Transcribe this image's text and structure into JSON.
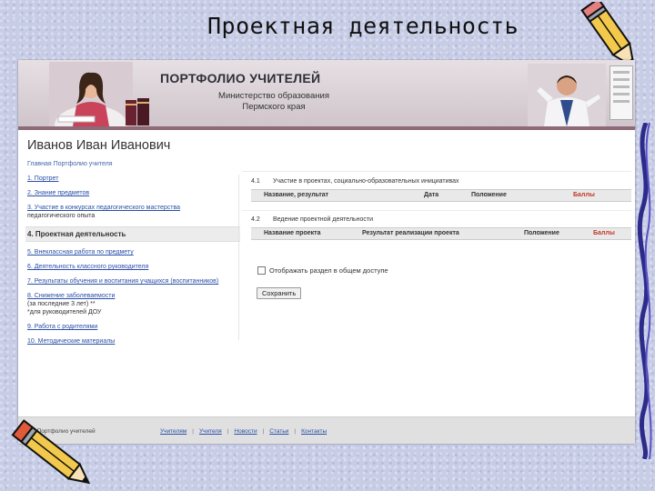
{
  "slide": {
    "title": "Проектная деятельность"
  },
  "header": {
    "site_title": "ПОРТФОЛИО УЧИТЕЛЕЙ",
    "ministry_line1": "Министерство образования",
    "ministry_line2": "Пермского края"
  },
  "user": {
    "name": "Иванов Иван Иванович"
  },
  "breadcrumb": "Главная   Портфолио учителя",
  "nav": {
    "items": [
      {
        "label": "1. Портрет"
      },
      {
        "label": "2. Знание предметов"
      },
      {
        "label": "3. Участие в конкурсах педагогического мастерства"
      },
      {
        "label": "4. Проектная деятельность"
      },
      {
        "label": "5. Внеклассная работа по предмету"
      },
      {
        "label": "6. Деятельность классного руководителя"
      },
      {
        "label": "7. Результаты обучения и воспитания учащихся (воспитанников)"
      },
      {
        "label": "8. Снижение заболеваемости"
      },
      {
        "label": "9. Работа с родителями"
      },
      {
        "label": "10. Методические материалы"
      }
    ],
    "item3_subtitle": "педагогического опыта",
    "item8_note1": "(за последние 3 лет) **",
    "item8_note2": "*для руководителей ДОУ"
  },
  "sections": [
    {
      "number": "4.1",
      "title": "Участие в проектах, социально-образовательных инициативах",
      "columns": [
        {
          "label": "Название, результат"
        },
        {
          "label": "Дата"
        },
        {
          "label": "Положение"
        },
        {
          "label": "Баллы",
          "color": "#c0392b"
        }
      ]
    },
    {
      "number": "4.2",
      "title": "Ведение проектной деятельности",
      "columns": [
        {
          "label": "Название проекта"
        },
        {
          "label": "Результат реализации проекта"
        },
        {
          "label": "Положение"
        },
        {
          "label": "Баллы",
          "color": "#c0392b"
        }
      ]
    }
  ],
  "form": {
    "checkbox_label": "Отображать раздел в общем доступе",
    "checkbox_checked": false,
    "save_label": "Сохранить"
  },
  "footer": {
    "copyright": "© Портфолио учителей",
    "links": [
      "Учителям",
      "Учителя",
      "Новости",
      "Статьи",
      "Контакты"
    ]
  },
  "colors": {
    "accent": "#8e6a78",
    "link": "#2a4fa8",
    "score": "#c0392b"
  }
}
